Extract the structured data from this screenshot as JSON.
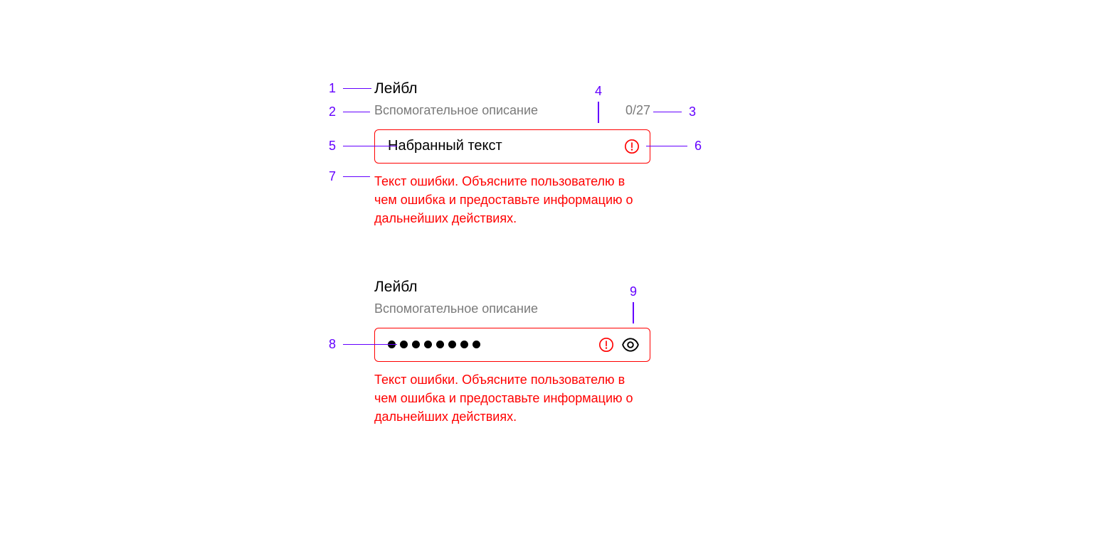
{
  "colors": {
    "error": "#ff0000",
    "annotation": "#6400ff",
    "muted": "#7a7a7a"
  },
  "annotations": {
    "a1": "1",
    "a2": "2",
    "a3": "3",
    "a4": "4",
    "a5": "5",
    "a6": "6",
    "a7": "7",
    "a8": "8",
    "a9": "9"
  },
  "field1": {
    "label": "Лейбл",
    "description": "Вспомогательное описание",
    "counter": "0/27",
    "value": "Набранный текст",
    "error": "Текст ошибки. Объясните пользователю в чем ошибка и предоставьте информацию о дальнейших действиях."
  },
  "field2": {
    "label": "Лейбл",
    "description": "Вспомогательное описание",
    "password_dot_count": 8,
    "error": "Текст ошибки. Объясните пользователю в чем ошибка и предоставьте информацию о дальнейших действиях."
  }
}
